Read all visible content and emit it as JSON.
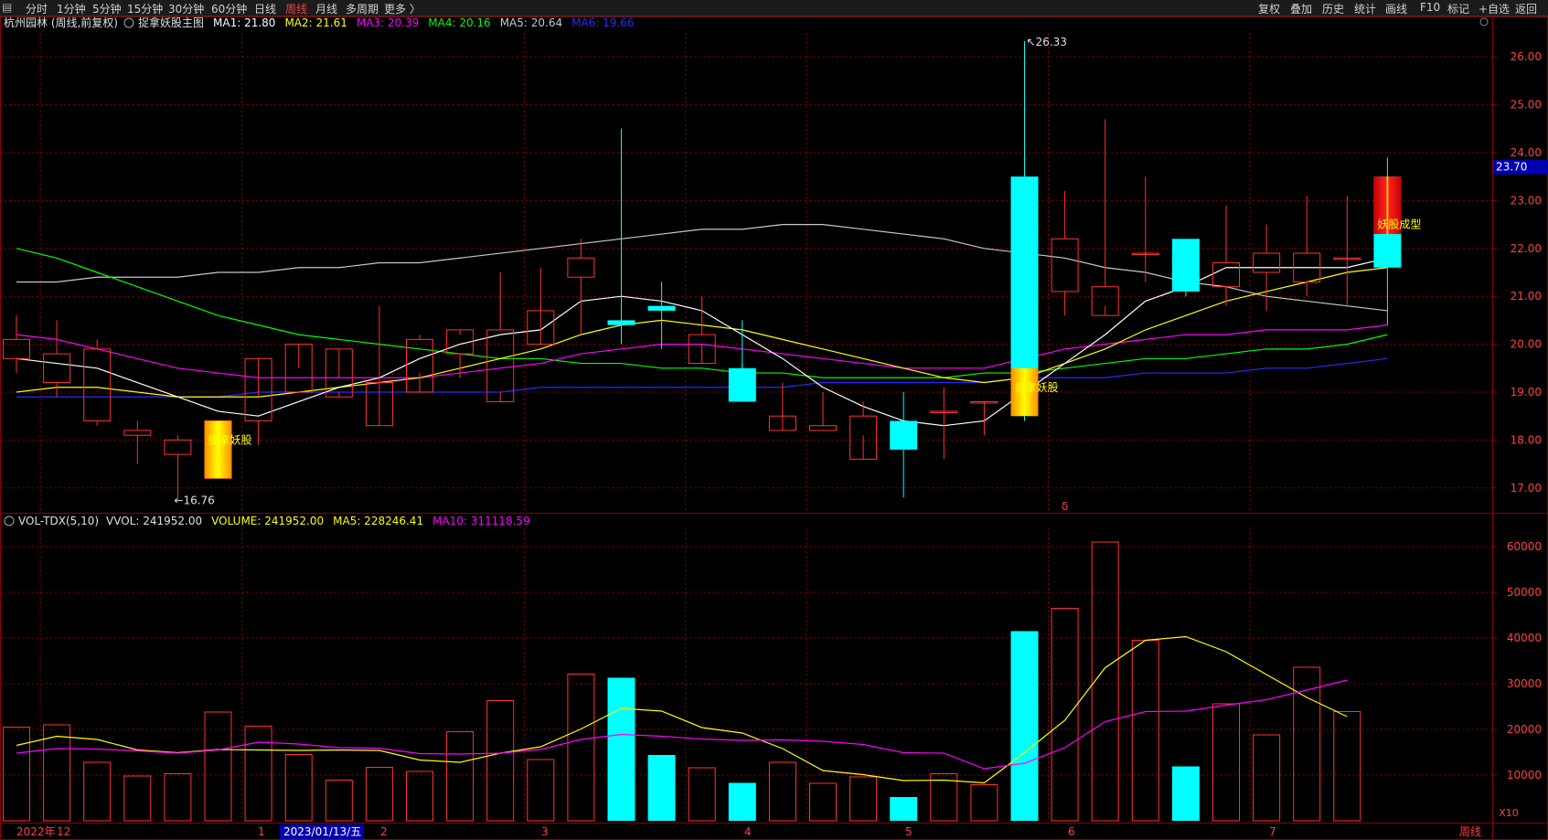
{
  "toolbar": {
    "periods": [
      "分时",
      "1分钟",
      "5分钟",
      "15分钟",
      "30分钟",
      "60分钟",
      "日线",
      "周线",
      "月线",
      "多周期",
      "更多 〉"
    ],
    "active_period": "周线",
    "right_buttons": [
      "复权",
      "叠加",
      "历史",
      "统计",
      "画线",
      "F10",
      "标记",
      "+自选",
      "返回"
    ]
  },
  "price_panel": {
    "stock_label": "杭州园林 (周线,前复权)",
    "indicator_name": "捉拿妖股主图",
    "ma_labels": [
      {
        "text": "MA1: 21.80",
        "color": "#ffffff"
      },
      {
        "text": "MA2: 21.61",
        "color": "#ffff00"
      },
      {
        "text": "MA3: 20.39",
        "color": "#ff00ff"
      },
      {
        "text": "MA4: 20.16",
        "color": "#00ff00"
      },
      {
        "text": "MA5: 20.64",
        "color": "#c8c8c8"
      },
      {
        "text": "MA6: 19.66",
        "color": "#2a2aff"
      }
    ],
    "y_ticks": [
      "26.00",
      "25.00",
      "24.00",
      "23.00",
      "22.00",
      "21.00",
      "20.00",
      "19.00",
      "18.00",
      "17.00"
    ],
    "current_price": "23.70",
    "high_label": "26.33",
    "low_label": "16.76",
    "signal_labels": [
      "捉拿妖股",
      "捉拿妖股",
      "妖股成型"
    ],
    "marker": "δ"
  },
  "volume_panel": {
    "title": "VOL-TDX(5,10)",
    "vvol": "VVOL: 241952.00",
    "volume": "VOLUME: 241952.00",
    "ma5": "MA5: 228246.41",
    "ma10": "MA10: 311118.59",
    "y_ticks": [
      "60000",
      "50000",
      "40000",
      "30000",
      "20000",
      "10000"
    ],
    "unit": "X10"
  },
  "x_axis": {
    "labels": [
      "2022年",
      "12",
      "1",
      "2023/01/13/五",
      "2",
      "3",
      "4",
      "5",
      "6",
      "7",
      "周线"
    ]
  },
  "colors": {
    "up": "#ff3232",
    "down": "#00ffff",
    "ma1": "#ffffff",
    "ma2": "#ffff00",
    "ma3": "#ff00ff",
    "ma4": "#00ff00",
    "ma5": "#c8c8c8",
    "ma6": "#2a2aff",
    "grid": "#8b0000",
    "axis_text": "#ff4040"
  },
  "chart_data": {
    "type": "candlestick",
    "price": {
      "open": [
        19.7,
        19.2,
        18.4,
        18.1,
        17.7,
        17.2,
        18.4,
        19.0,
        18.9,
        18.3,
        19.0,
        19.8,
        18.8,
        20.0,
        21.4,
        20.5,
        20.8,
        19.6,
        19.5,
        18.2,
        18.2,
        17.6,
        18.4,
        18.6,
        18.8,
        23.5,
        21.1,
        20.6,
        21.9,
        22.2,
        21.2,
        21.5,
        21.3,
        21.8,
        23.5
      ],
      "high": [
        20.6,
        20.5,
        20.1,
        18.4,
        18.1,
        18.2,
        18.9,
        19.5,
        19.3,
        20.8,
        20.2,
        20.2,
        21.5,
        21.6,
        22.2,
        24.5,
        21.3,
        21.0,
        20.5,
        19.2,
        19.0,
        18.8,
        19.0,
        19.1,
        18.8,
        26.33,
        23.2,
        24.7,
        23.5,
        22.2,
        22.9,
        22.5,
        23.1,
        23.1,
        23.9
      ],
      "low": [
        19.4,
        18.9,
        18.3,
        17.5,
        16.76,
        17.2,
        17.9,
        19.0,
        19.0,
        19.2,
        19.4,
        19.3,
        19.0,
        20.8,
        20.2,
        20.0,
        19.9,
        20.0,
        19.6,
        18.6,
        18.2,
        18.1,
        16.8,
        17.6,
        18.1,
        18.4,
        20.6,
        20.8,
        21.3,
        21.0,
        20.8,
        20.7,
        21.0,
        20.8,
        20.4
      ],
      "close": [
        20.1,
        19.8,
        19.9,
        18.2,
        18.0,
        18.4,
        19.7,
        20.0,
        19.9,
        19.2,
        20.1,
        20.3,
        20.3,
        20.7,
        21.8,
        20.4,
        20.7,
        20.2,
        18.8,
        18.5,
        18.3,
        18.5,
        17.8,
        18.6,
        18.8,
        18.5,
        22.2,
        21.2,
        21.9,
        21.1,
        21.7,
        21.9,
        21.9,
        21.8,
        21.6
      ],
      "ma1": [
        19.7,
        19.6,
        19.5,
        19.2,
        18.9,
        18.6,
        18.5,
        18.8,
        19.1,
        19.3,
        19.7,
        20.0,
        20.2,
        20.3,
        20.9,
        21.0,
        20.9,
        20.7,
        20.2,
        19.7,
        19.1,
        18.7,
        18.4,
        18.3,
        18.4,
        19.0,
        19.6,
        20.2,
        20.9,
        21.2,
        21.6,
        21.6,
        21.6,
        21.6,
        21.8
      ],
      "ma2": [
        19.0,
        19.1,
        19.1,
        19.0,
        18.9,
        18.9,
        18.9,
        19.0,
        19.1,
        19.2,
        19.3,
        19.5,
        19.7,
        19.9,
        20.2,
        20.4,
        20.5,
        20.4,
        20.3,
        20.1,
        19.9,
        19.7,
        19.5,
        19.3,
        19.2,
        19.3,
        19.6,
        19.9,
        20.3,
        20.6,
        20.9,
        21.1,
        21.3,
        21.5,
        21.6
      ],
      "ma3": [
        20.2,
        20.1,
        19.9,
        19.7,
        19.5,
        19.4,
        19.3,
        19.3,
        19.3,
        19.3,
        19.3,
        19.4,
        19.5,
        19.6,
        19.8,
        19.9,
        20.0,
        20.0,
        19.9,
        19.8,
        19.7,
        19.6,
        19.5,
        19.5,
        19.5,
        19.7,
        19.9,
        20.0,
        20.1,
        20.2,
        20.2,
        20.3,
        20.3,
        20.3,
        20.4
      ],
      "ma4": [
        22.0,
        21.8,
        21.5,
        21.2,
        20.9,
        20.6,
        20.4,
        20.2,
        20.1,
        20.0,
        19.9,
        19.8,
        19.7,
        19.7,
        19.6,
        19.6,
        19.5,
        19.5,
        19.4,
        19.4,
        19.3,
        19.3,
        19.3,
        19.3,
        19.4,
        19.4,
        19.5,
        19.6,
        19.7,
        19.7,
        19.8,
        19.9,
        19.9,
        20.0,
        20.2
      ],
      "ma5": [
        21.3,
        21.3,
        21.4,
        21.4,
        21.4,
        21.5,
        21.5,
        21.6,
        21.6,
        21.7,
        21.7,
        21.8,
        21.9,
        22.0,
        22.1,
        22.2,
        22.3,
        22.4,
        22.4,
        22.5,
        22.5,
        22.4,
        22.3,
        22.2,
        22.0,
        21.9,
        21.8,
        21.6,
        21.5,
        21.3,
        21.2,
        21.0,
        20.9,
        20.8,
        20.7
      ],
      "ma6": [
        18.9,
        18.9,
        18.9,
        18.9,
        18.9,
        18.9,
        19.0,
        19.0,
        19.0,
        19.0,
        19.0,
        19.0,
        19.0,
        19.1,
        19.1,
        19.1,
        19.1,
        19.1,
        19.1,
        19.1,
        19.2,
        19.2,
        19.2,
        19.2,
        19.2,
        19.3,
        19.3,
        19.3,
        19.4,
        19.4,
        19.4,
        19.5,
        19.5,
        19.6,
        19.7
      ],
      "ylim": [
        16.5,
        26.5
      ]
    },
    "volume": {
      "values": [
        20500,
        21000,
        12800,
        9800,
        10300,
        23800,
        20700,
        14500,
        8900,
        11700,
        10800,
        19500,
        26300,
        13400,
        32100,
        31300,
        14400,
        11600,
        8300,
        12800,
        8200,
        9600,
        5200,
        10300,
        7900,
        41500,
        46500,
        61000,
        39500,
        11900,
        25600,
        18800,
        33600,
        23900
      ],
      "ma5": [
        16500,
        18500,
        17800,
        15500,
        14900,
        15600,
        15500,
        15400,
        15500,
        15400,
        13300,
        12800,
        14800,
        16200,
        20100,
        24600,
        24000,
        20400,
        19200,
        15800,
        11000,
        10100,
        8800,
        8900,
        8300,
        14900,
        22000,
        33500,
        39500,
        40300,
        37000,
        32000,
        27000,
        22800
      ],
      "ma10": [
        14800,
        15800,
        15700,
        15300,
        14800,
        15500,
        17200,
        16800,
        16000,
        15900,
        14700,
        14600,
        14800,
        15600,
        17800,
        18900,
        18500,
        17900,
        17600,
        17700,
        17400,
        16700,
        14900,
        14800,
        11400,
        12600,
        16000,
        21700,
        23900,
        24000,
        25300,
        26500,
        28600,
        30800
      ],
      "ylim": [
        0,
        64000
      ]
    }
  }
}
